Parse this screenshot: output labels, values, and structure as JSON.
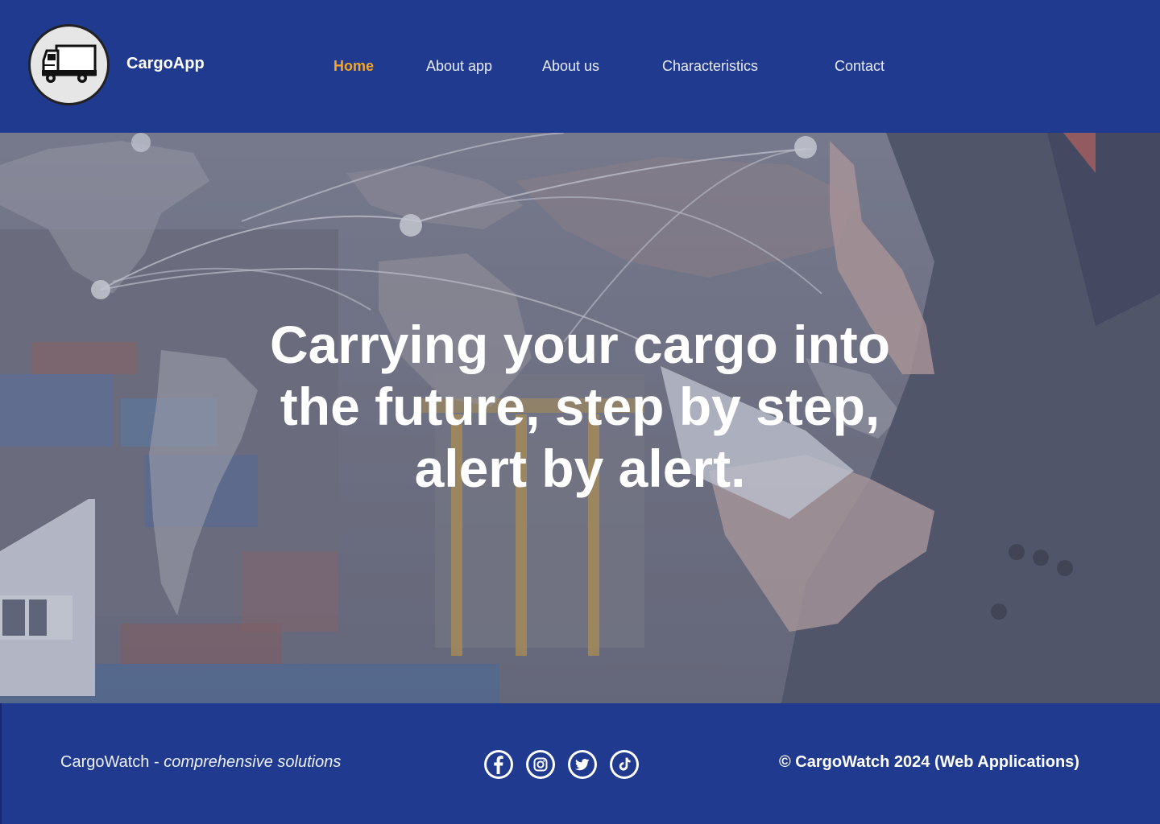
{
  "header": {
    "brand": "CargoApp",
    "logo_icon": "truck-icon",
    "nav": [
      {
        "label": "Home",
        "active": true
      },
      {
        "label": "About app",
        "active": false
      },
      {
        "label": "About us",
        "active": false
      },
      {
        "label": "Characteristics",
        "active": false
      },
      {
        "label": "Contact",
        "active": false
      }
    ]
  },
  "hero": {
    "headline": "Carrying your cargo into the future, step by step, alert by alert."
  },
  "footer": {
    "company": "CargoWatch",
    "separator": " - ",
    "tagline": "comprehensive solutions",
    "social_icons": [
      "facebook-icon",
      "instagram-icon",
      "twitter-icon",
      "tiktok-icon"
    ],
    "copyright": "© CargoWatch 2024 (Web Applications)"
  },
  "colors": {
    "primary": "#1f3a8f",
    "accent": "#f5a623",
    "text": "#ffffff"
  }
}
